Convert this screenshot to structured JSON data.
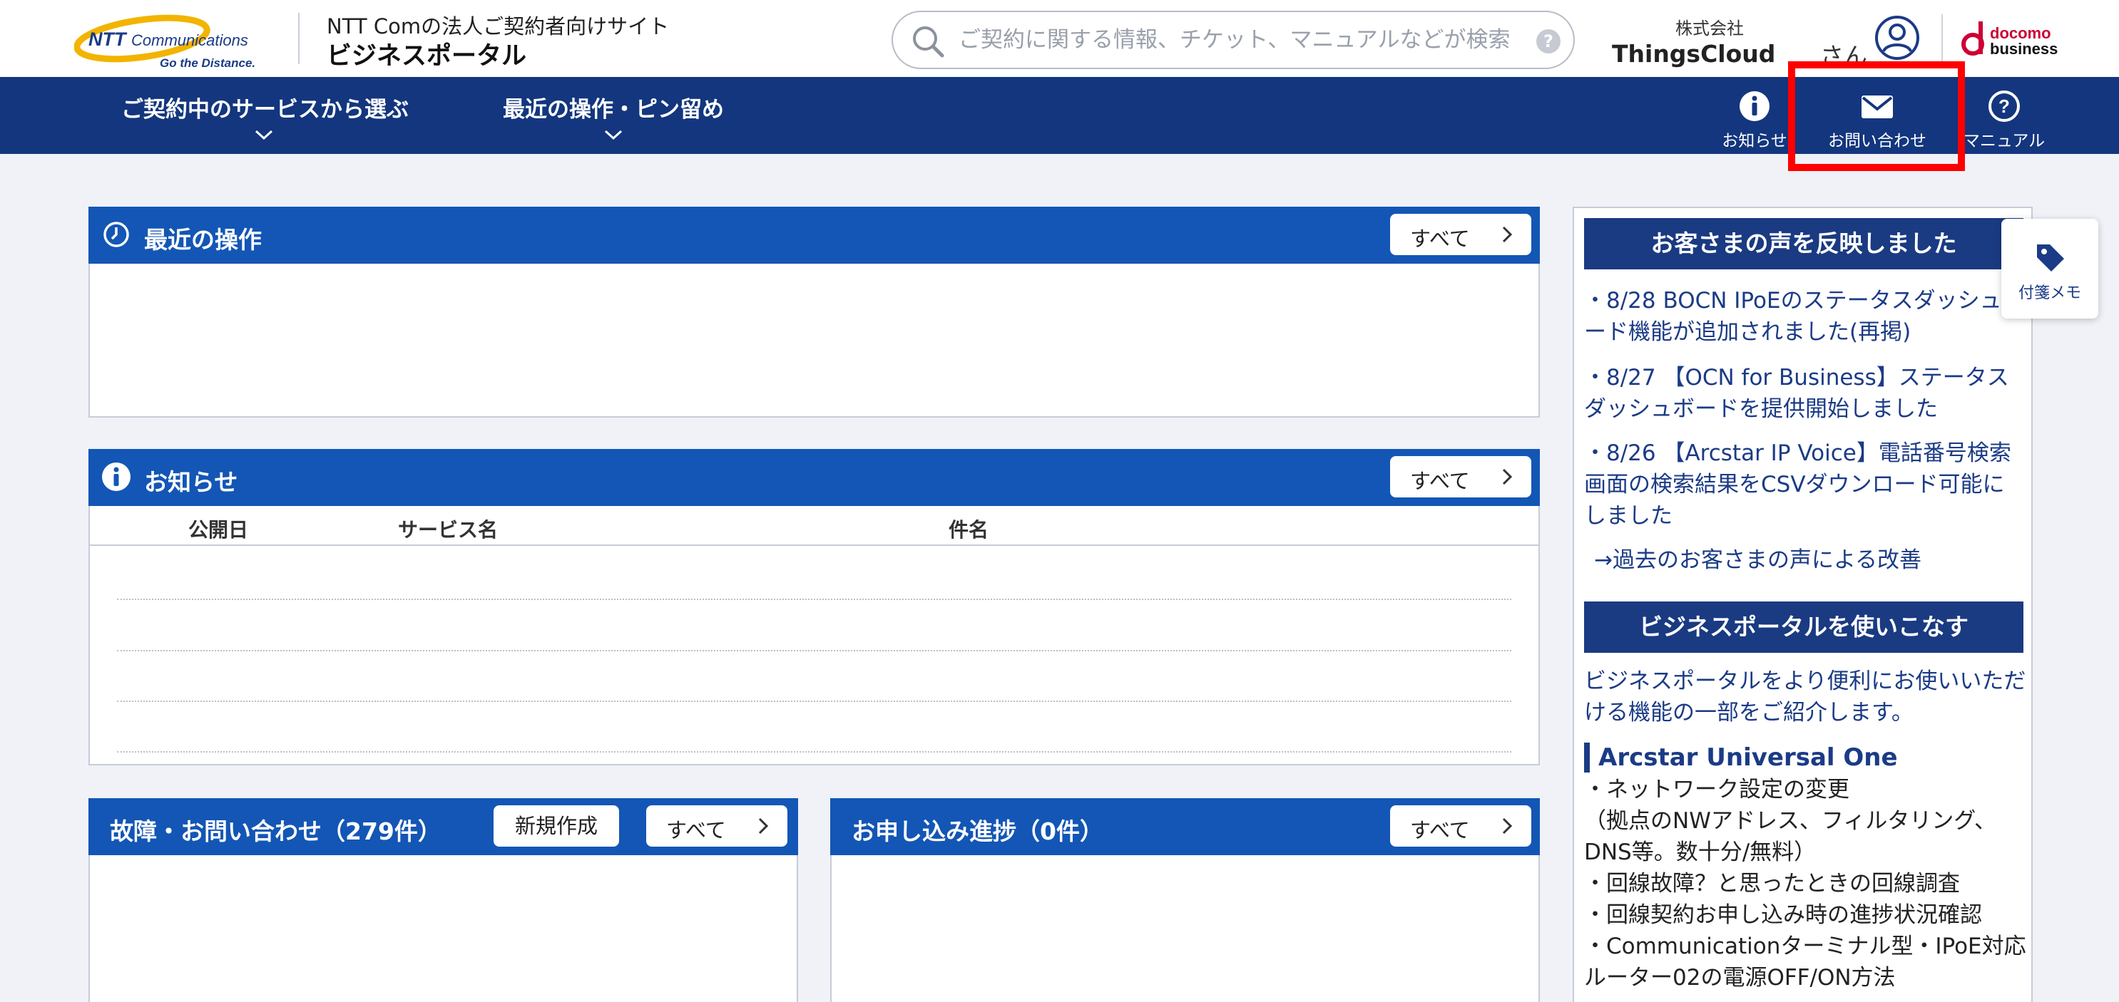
{
  "header": {
    "logo_brand": "NTT Communications",
    "logo_tagline": "Go the Distance.",
    "site_subtitle": "NTT Comの法人ご契約者向けサイト",
    "site_title": "ビジネスポータル",
    "search_placeholder": "ご契約に関する情報、チケット、マニュアルなどが検索",
    "search_help": "?",
    "company_type": "株式会社",
    "company_name": "ThingsCloud",
    "user_suffix": "さん",
    "partner_logo": "docomo business"
  },
  "nav": {
    "services": "ご契約中のサービスから選ぶ",
    "recent": "最近の操作・ピン留め",
    "info": "お知らせ",
    "contact": "お問い合わせ",
    "manual": "マニュアル"
  },
  "panels": {
    "recent": {
      "title": "最近の操作",
      "all": "すべて"
    },
    "news": {
      "title": "お知らせ",
      "all": "すべて",
      "columns": [
        "公開日",
        "サービス名",
        "件名"
      ]
    },
    "faults": {
      "title": "故障・お問い合わせ（279件）",
      "new": "新規作成",
      "all": "すべて"
    },
    "apply": {
      "title": "お申し込み進捗（0件）",
      "all": "すべて"
    }
  },
  "sidebar": {
    "voice_head": "お客さまの声を反映しました",
    "voice_items": [
      "・8/28 BOCN IPoEのステータスダッシュボード機能が追加されました(再掲)",
      "・8/27 【OCN for Business】ステータスダッシュボードを提供開始しました",
      "・8/26 【Arcstar IP Voice】電話番号検索画面の検索結果をCSVダウンロード可能にしました"
    ],
    "voice_more": "→過去のお客さまの声による改善",
    "use_head": "ビジネスポータルを使いこなす",
    "use_desc": "ビジネスポータルをより便利にお使いいただける機能の一部をご紹介します。",
    "section_title": "Arcstar Universal One",
    "section_items": [
      "・ネットワーク設定の変更",
      "（拠点のNWアドレス、フィルタリング、DNS等。数十分/無料）",
      "・回線故障？と思ったときの回線調査",
      "・回線契約お申し込み時の進捗状況確認",
      "・Communicationターミナル型・IPoE対応ルーター02の電源OFF/ON方法"
    ]
  },
  "memo_tab": "付箋メモ",
  "colors": {
    "nav_bg": "#13367e",
    "panel_head": "#1356b5",
    "sidebar_head": "#1a3a82",
    "highlight": "#ff0000",
    "page_bg": "#f0f2f8"
  }
}
